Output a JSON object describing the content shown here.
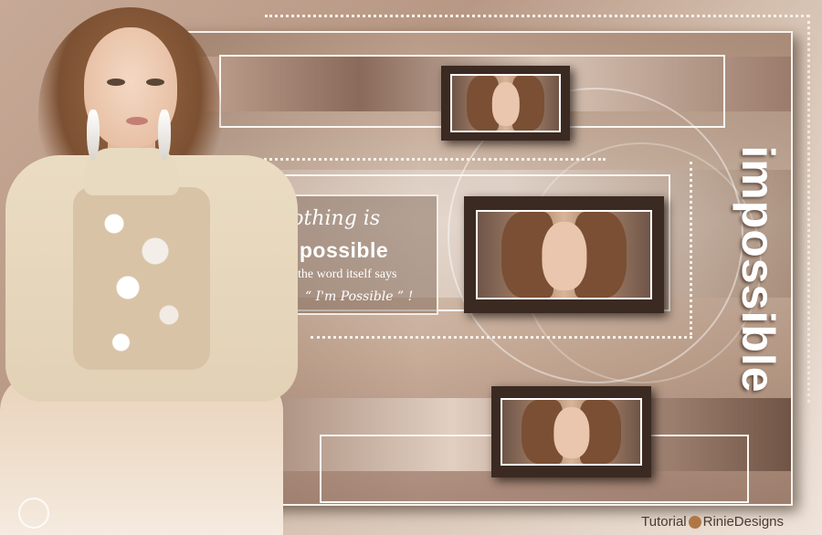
{
  "quote": {
    "line1": "Nothing is",
    "line2": "impossible",
    "line3": "the word itself says",
    "line4": "“ I'm Possible ” !"
  },
  "vertical_word": "impossible",
  "credit": {
    "prefix": "Tutorial",
    "brand": "RinieDesigns"
  },
  "colors": {
    "frame_border": "#f8f2ec",
    "tone_light": "#efe4da",
    "tone_mid": "#c6a996",
    "tone_dark": "#3b2a22"
  },
  "icons": [
    "corner-signature-icon",
    "rinie-logo-icon"
  ]
}
